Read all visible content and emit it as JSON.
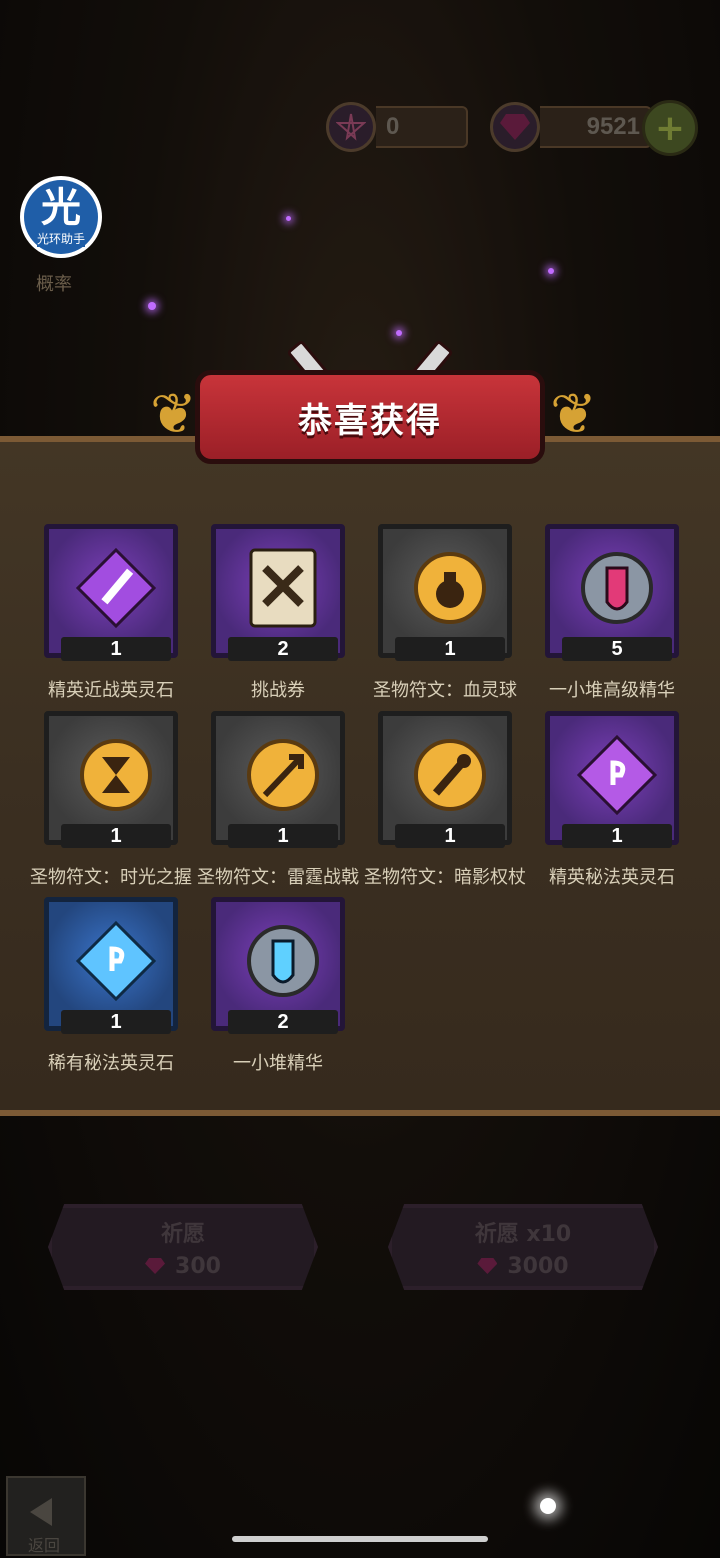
{
  "currency": {
    "pentagram_value": "0",
    "gem_value": "9521",
    "plus_label": "+"
  },
  "helper": {
    "logo_char": "光",
    "logo_text": "光环助手",
    "prob_label": "概率"
  },
  "banner": {
    "title": "恭喜获得"
  },
  "items": [
    {
      "name": "精英近战英灵石",
      "count": "1",
      "frame": "purple",
      "icon": "purple-crystal-sword-icon"
    },
    {
      "name": "挑战券",
      "count": "2",
      "frame": "purple",
      "icon": "challenge-ticket-icon"
    },
    {
      "name": "圣物符文：血灵球",
      "count": "1",
      "frame": "gray",
      "icon": "blood-orb-rune-icon"
    },
    {
      "name": "一小堆高级精华",
      "count": "5",
      "frame": "purple",
      "icon": "essence-vial-red-icon"
    },
    {
      "name": "圣物符文：时光之握",
      "count": "1",
      "frame": "gray",
      "icon": "hourglass-rune-icon"
    },
    {
      "name": "圣物符文：雷霆战戟",
      "count": "1",
      "frame": "gray",
      "icon": "thunder-halberd-rune-icon"
    },
    {
      "name": "圣物符文：暗影权杖",
      "count": "1",
      "frame": "gray",
      "icon": "shadow-scepter-rune-icon"
    },
    {
      "name": "精英秘法英灵石",
      "count": "1",
      "frame": "purple",
      "icon": "purple-crystal-magic-icon"
    },
    {
      "name": "稀有秘法英灵石",
      "count": "1",
      "frame": "blue",
      "icon": "blue-crystal-magic-icon"
    },
    {
      "name": "一小堆精华",
      "count": "2",
      "frame": "purple",
      "icon": "essence-vial-blue-icon"
    }
  ],
  "buttons": {
    "wish_label": "祈愿",
    "wish_cost": "300",
    "wish10_label": "祈愿 x10",
    "wish10_cost": "3000",
    "back_label": "返回"
  },
  "colors": {
    "banner_red": "#c8343a",
    "gold": "#d6a234",
    "panel": "#3b2f21"
  }
}
